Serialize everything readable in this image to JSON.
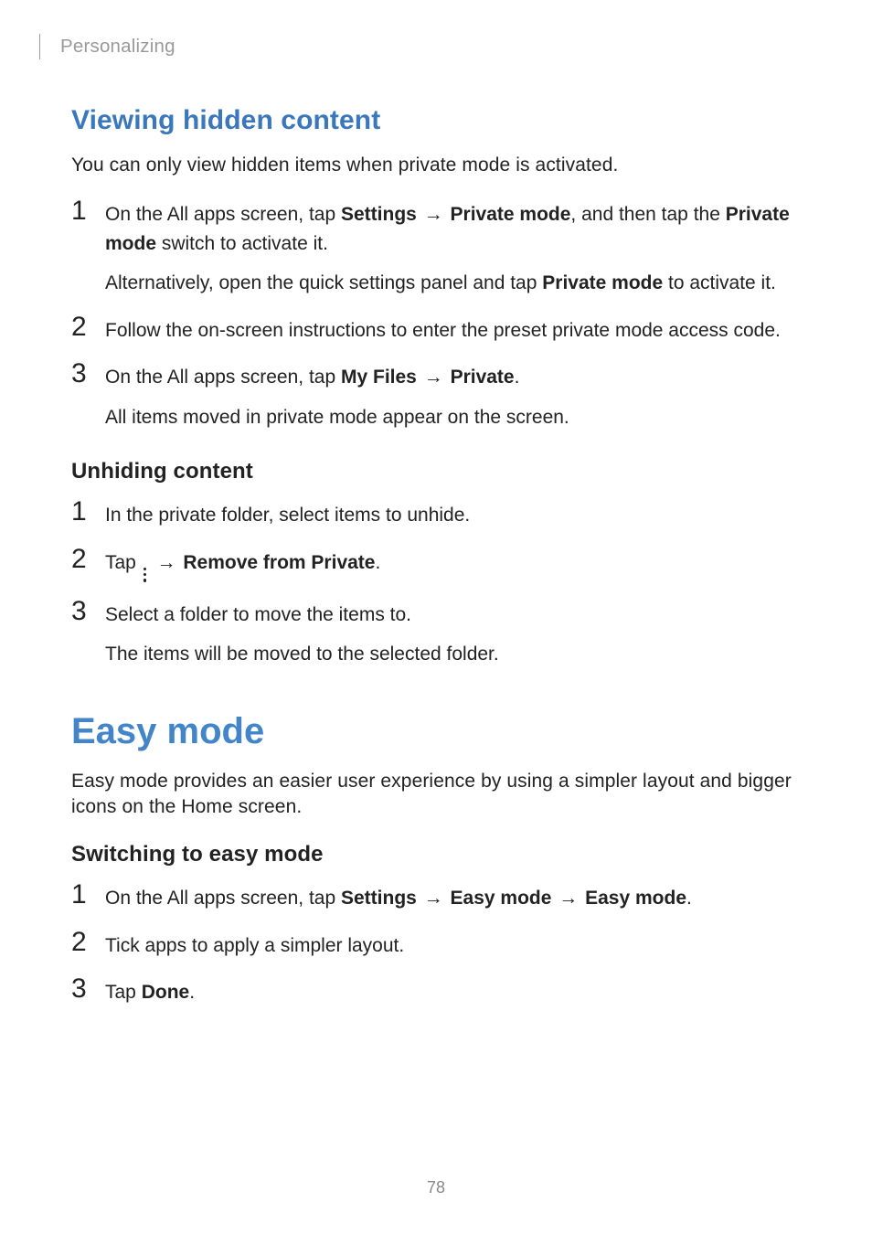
{
  "breadcrumb": "Personalizing",
  "page_number": "78",
  "arrow": "→",
  "section1": {
    "heading": "Viewing hidden content",
    "intro": "You can only view hidden items when private mode is activated.",
    "steps": [
      {
        "num": "1",
        "line1_a": "On the All apps screen, tap ",
        "bold1": "Settings",
        "line1_b": " ",
        "bold2": "Private mode",
        "line1_c": ", and then tap the ",
        "bold3": "Private mode",
        "line1_d": " switch to activate it.",
        "line2_a": "Alternatively, open the quick settings panel and tap ",
        "bold4": "Private mode",
        "line2_b": " to activate it."
      },
      {
        "num": "2",
        "text": "Follow the on-screen instructions to enter the preset private mode access code."
      },
      {
        "num": "3",
        "line1_a": "On the All apps screen, tap ",
        "bold1": "My Files",
        "line1_b": " ",
        "bold2": "Private",
        "line1_c": ".",
        "line2": "All items moved in private mode appear on the screen."
      }
    ]
  },
  "section2": {
    "heading": "Unhiding content",
    "steps": [
      {
        "num": "1",
        "text": "In the private folder, select items to unhide."
      },
      {
        "num": "2",
        "pre": "Tap ",
        "post": " ",
        "bold": "Remove from Private",
        "end": "."
      },
      {
        "num": "3",
        "line1": "Select a folder to move the items to.",
        "line2": "The items will be moved to the selected folder."
      }
    ]
  },
  "section3": {
    "heading": "Easy mode",
    "intro": "Easy mode provides an easier user experience by using a simpler layout and bigger icons on the Home screen.",
    "sub": "Switching to easy mode",
    "steps": [
      {
        "num": "1",
        "pre": "On the All apps screen, tap ",
        "b1": "Settings",
        "b2": "Easy mode",
        "b3": "Easy mode",
        "end": "."
      },
      {
        "num": "2",
        "text": "Tick apps to apply a simpler layout."
      },
      {
        "num": "3",
        "pre": "Tap ",
        "bold": "Done",
        "end": "."
      }
    ]
  }
}
